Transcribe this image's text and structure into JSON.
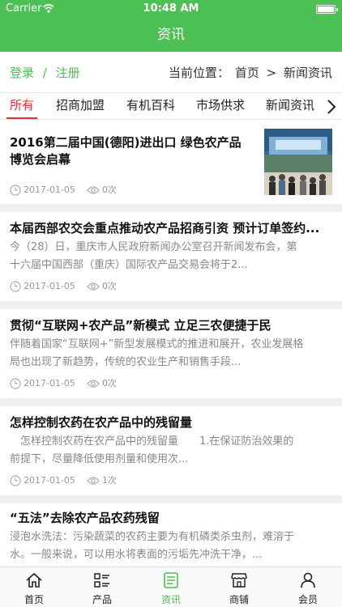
{
  "status_bar": {
    "carrier": "Carrier",
    "time": "10:48 AM",
    "battery_level": 1.0
  },
  "nav": {
    "title": "资讯"
  },
  "location_bar": {
    "login": "登录",
    "separator": "/",
    "register": "注册",
    "position_label": "当前位置：",
    "breadcrumb_home": "首页",
    "breadcrumb_sep": ">",
    "breadcrumb_current": "新闻资讯"
  },
  "tabs": [
    {
      "label": "所有",
      "active": true
    },
    {
      "label": "招商加盟",
      "active": false
    },
    {
      "label": "有机百科",
      "active": false
    },
    {
      "label": "市场供求",
      "active": false
    },
    {
      "label": "新闻资讯",
      "active": false
    }
  ],
  "articles": [
    {
      "title_line1": "2016第二届中国(德阳)进出口 绿色农产品",
      "title_line2": "博览会启幕",
      "summary_line1": "",
      "summary_line2": "",
      "date": "2017-01-05",
      "views": "0次",
      "has_image": true
    },
    {
      "title_line1": "本届西部农交会重点推动农产品招商引资 预计订单签约...",
      "title_line2": "",
      "summary_line1": "今（28）日，重庆市人民政府新闻办公室召开新闻发布会，第",
      "summary_line2": "十六届中国西部（重庆）国际农产品交易会将于2...",
      "date": "2017-01-05",
      "views": "0次",
      "has_image": false
    },
    {
      "title_line1": "贯彻“互联网+农产品”新模式 立足三农便捷于民",
      "title_line2": "",
      "summary_line1": "伴随着国家“互联网+”新型发展模式的推进和展开，农业发展格",
      "summary_line2": "局也出现了新趋势，传统的农业生产和销售手段...",
      "date": "2017-01-05",
      "views": "0次",
      "has_image": false
    },
    {
      "title_line1": "怎样控制农药在农产品中的残留量",
      "title_line2": "",
      "summary_line1": "　怎样控制农药在农产品中的残留量　　1.在保证防治效果的",
      "summary_line2": "前提下，尽量降低使用剂量和使用次...",
      "date": "2017-01-05",
      "views": "1次",
      "has_image": false
    },
    {
      "title_line1": "“五法”去除农产品农药残留",
      "title_line2": "",
      "summary_line1": "浸泡水洗法：污染蔬菜的农药主要为有机磷类杀虫剂，难溶于",
      "summary_line2": "水。一般来说，可以用水将表面的污垢先冲洗干净，...",
      "date": "",
      "views": "",
      "has_image": false
    }
  ],
  "tab_bar": [
    {
      "label": "首页",
      "icon": "home-icon",
      "active": false
    },
    {
      "label": "产品",
      "icon": "list-icon",
      "active": false
    },
    {
      "label": "资讯",
      "icon": "news-icon",
      "active": true
    },
    {
      "label": "商铺",
      "icon": "shop-icon",
      "active": false
    },
    {
      "label": "会员",
      "icon": "user-icon",
      "active": false
    }
  ],
  "colors": {
    "brand": "#4cbf55",
    "active_tab": "#e53030"
  }
}
